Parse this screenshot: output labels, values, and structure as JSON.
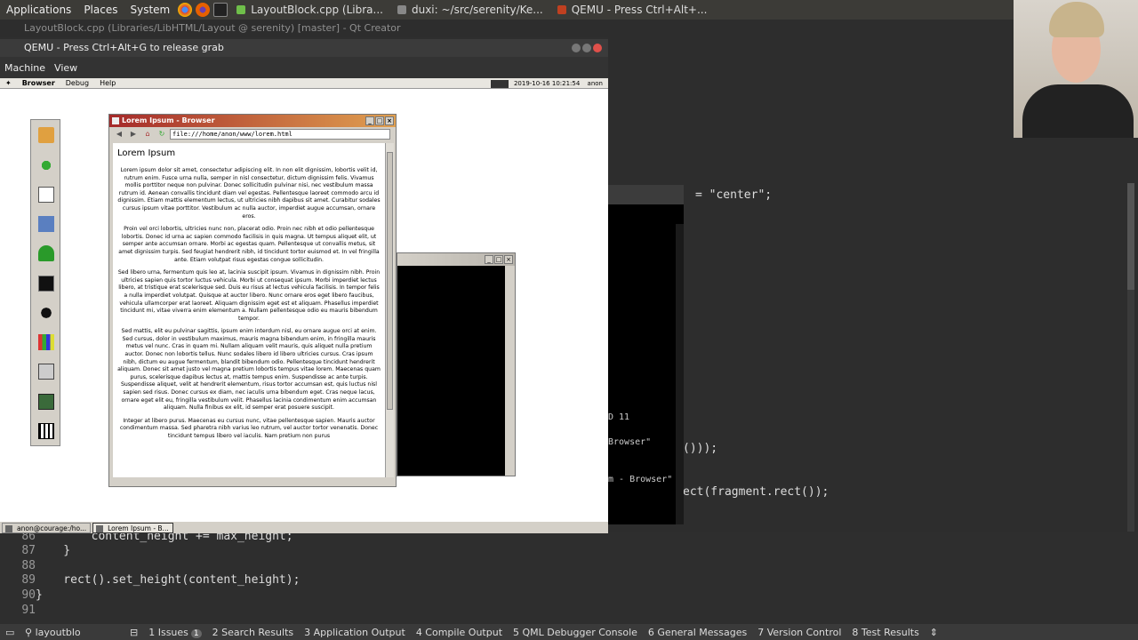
{
  "top_panel": {
    "menus": [
      "Applications",
      "Places",
      "System"
    ],
    "tasks": [
      {
        "label": "LayoutBlock.cpp (Libra...",
        "color": "#6fbf4a"
      },
      {
        "label": "duxi: ~/src/serenity/Ke...",
        "color": "#888888"
      },
      {
        "label": "QEMU - Press Ctrl+Alt+...",
        "color": "#c04020"
      }
    ]
  },
  "qt_creator": {
    "title": "LayoutBlock.cpp (Libraries/LibHTML/Layout @ serenity) [master] - Qt Creator"
  },
  "qemu": {
    "title": "QEMU - Press Ctrl+Alt+G to release grab",
    "menus": [
      "Machine",
      "View"
    ]
  },
  "serenity": {
    "menus": [
      "Browser",
      "Debug",
      "Help"
    ],
    "clock": "2019-10-16 10:21:54",
    "user": "anon",
    "browser": {
      "title": "Lorem Ipsum - Browser",
      "url": "file:///home/anon/www/lorem.html",
      "heading": "Lorem Ipsum",
      "paragraphs": [
        "Lorem ipsum dolor sit amet, consectetur adipiscing elit. In non elit dignissim, lobortis velit id, rutrum enim. Fusce urna nulla, semper in nisl consectetur, dictum dignissim felis. Vivamus mollis porttitor neque non pulvinar. Donec sollicitudin pulvinar nisi, nec vestibulum massa rutrum id. Aenean convallis tincidunt diam vel egestas. Pellentesque laoreet commodo arcu id dignissim. Etiam mattis elementum lectus, ut ultricies nibh dapibus sit amet. Curabitur sodales cursus ipsum vitae porttitor. Vestibulum ac nulla auctor, imperdiet augue accumsan, ornare eros.",
        "Proin vel orci lobortis, ultricies nunc non, placerat odio. Proin nec nibh et odio pellentesque lobortis. Donec id urna ac sapien commodo facilisis in quis magna. Ut tempus aliquet elit, ut semper ante accumsan ornare. Morbi ac egestas quam. Pellentesque ut convallis metus, sit amet dignissim turpis. Sed feugiat hendrerit nibh, id tincidunt tortor euismod et. In vel fringilla ante. Etiam volutpat risus egestas congue sollicitudin.",
        "Sed libero urna, fermentum quis leo at, lacinia suscipit ipsum. Vivamus in dignissim nibh. Proin ultricies sapien quis tortor luctus vehicula. Morbi ut consequat ipsum. Morbi imperdiet lectus libero, at tristique erat scelerisque sed. Duis eu risus at lectus vehicula facilisis. In tempor felis a nulla imperdiet volutpat. Quisque at auctor libero. Nunc ornare eros eget libero faucibus, vehicula ullamcorper erat laoreet. Aliquam dignissim eget est et aliquam. Phasellus imperdiet tincidunt mi, vitae viverra enim elementum a. Nullam pellentesque odio eu mauris bibendum tempor.",
        "Sed mattis, elit eu pulvinar sagittis, ipsum enim interdum nisl, eu ornare augue orci at enim. Sed cursus, dolor in vestibulum maximus, mauris magna bibendum enim, in fringilla mauris metus vel nunc. Cras in quam mi. Nullam aliquam velit mauris, quis aliquet nulla pretium auctor. Donec non lobortis tellus. Nunc sodales libero id libero ultricies cursus. Cras ipsum nibh, dictum eu augue fermentum, blandit bibendum odio. Pellentesque tincidunt hendrerit aliquam. Donec sit amet justo vel magna pretium lobortis tempus vitae lorem. Maecenas quam purus, scelerisque dapibus lectus at, mattis tempus enim. Suspendisse ac ante turpis. Suspendisse aliquet, velit at hendrerit elementum, risus tortor accumsan est, quis luctus nisl sapien sed risus. Donec cursus ex diam, nec iaculis urna bibendum eget. Cras neque lacus, ornare eget elit eu, fringilla vestibulum velit. Phasellus lacinia condimentum enim accumsan aliquam. Nulla finibus ex elit, id semper erat posuere suscipit.",
        "Integer at libero purus. Maecenas eu cursus nunc, vitae pellentesque sapien. Mauris auctor condimentum massa. Sed pharetra nibh varius leo rutrum, vel auctor tortor venenatis. Donec tincidunt tempus libero vel iaculis. Nam pretium non purus"
      ]
    },
    "taskbar": [
      {
        "label": "anon@courage:/ho...",
        "active": false
      },
      {
        "label": "Lorem Ipsum - B...",
        "active": true
      }
    ]
  },
  "right_editor": {
    "frag_center": "= \"center\";",
    "frag_paren": "()));",
    "frag_rect": "ect(fragment.rect());",
    "term_id": "D 11",
    "term_browser1": "Browser\"",
    "term_browser2": "m - Browser\""
  },
  "code": [
    {
      "ln": "86",
      "text": "        content_height += max_height;"
    },
    {
      "ln": "87",
      "text": "    }"
    },
    {
      "ln": "88",
      "text": ""
    },
    {
      "ln": "89",
      "text": "    rect().set_height(content_height);"
    },
    {
      "ln": "90",
      "text": "}"
    },
    {
      "ln": "91",
      "text": ""
    }
  ],
  "status_bar": {
    "locator": "layoutblo",
    "items": [
      {
        "label": "1 Issues",
        "badge": "1"
      },
      {
        "label": "2 Search Results"
      },
      {
        "label": "3 Application Output"
      },
      {
        "label": "4 Compile Output"
      },
      {
        "label": "5 QML Debugger Console"
      },
      {
        "label": "6 General Messages"
      },
      {
        "label": "7 Version Control"
      },
      {
        "label": "8 Test Results"
      }
    ]
  }
}
